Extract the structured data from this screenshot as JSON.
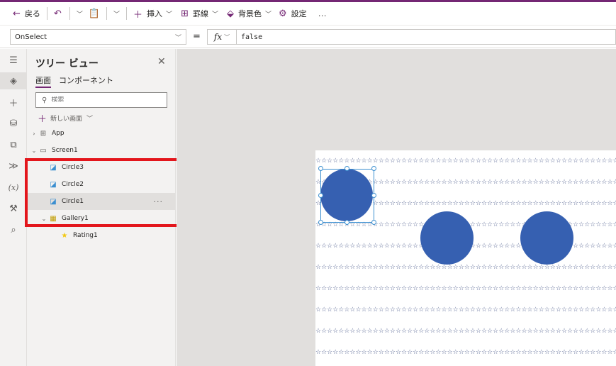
{
  "toolbar": {
    "back_label": "戻る",
    "insert_label": "挿入",
    "border_label": "罫線",
    "bgcolor_label": "背景色",
    "settings_label": "設定",
    "more_label": "…"
  },
  "formula_bar": {
    "property": "OnSelect",
    "equals": "=",
    "fx_label": "fx",
    "formula": "false"
  },
  "tree_view": {
    "title": "ツリー ビュー",
    "tabs": [
      "画面",
      "コンポーネント"
    ],
    "search_placeholder": "検索",
    "new_screen_label": "新しい画面",
    "nodes": {
      "app": "App",
      "screen1": "Screen1",
      "circle3": "Circle3",
      "circle2": "Circle2",
      "circle1": "Circle1",
      "gallery1": "Gallery1",
      "rating1": "Rating1"
    },
    "selected_node": "Circle1"
  },
  "canvas": {
    "star_row_text": "☆☆☆☆☆☆☆☆☆☆☆☆☆☆☆☆☆☆☆☆☆☆☆☆☆☆☆☆☆☆☆☆☆☆☆☆☆☆☆☆☆☆☆☆☆☆☆☆☆☆☆☆☆☆☆☆☆☆☆☆☆☆☆☆☆☆☆☆",
    "circle_color": "#3660b1"
  },
  "colors": {
    "accent": "#742774",
    "highlight": "#e3161c",
    "selection": "#3b8fd0"
  }
}
